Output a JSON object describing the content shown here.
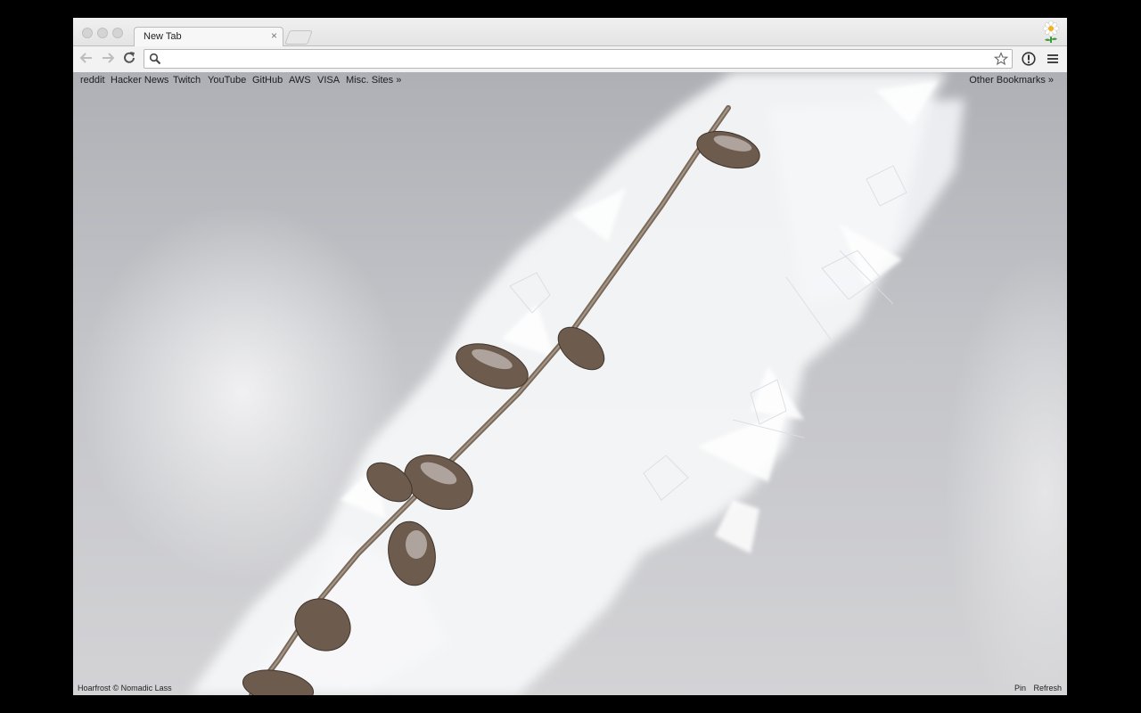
{
  "tab": {
    "title": "New Tab",
    "close_glyph": "×"
  },
  "omnibox": {
    "value": "",
    "placeholder": ""
  },
  "bookmarks": [
    {
      "label": "reddit"
    },
    {
      "label": "Hacker News"
    },
    {
      "label": "Twitch"
    },
    {
      "label": "YouTube"
    },
    {
      "label": "GitHub"
    },
    {
      "label": "AWS"
    },
    {
      "label": "VISA"
    },
    {
      "label": "Misc. Sites »"
    }
  ],
  "other_bookmarks": "Other Bookmarks »",
  "footer": {
    "credit": "Hoarfrost © Nomadic Lass",
    "pin": "Pin",
    "refresh": "Refresh"
  },
  "icons": {
    "back": "back-arrow-icon",
    "forward": "forward-arrow-icon",
    "reload": "reload-icon",
    "search": "search-icon",
    "star": "star-icon",
    "info": "info-icon",
    "menu": "hamburger-menu-icon",
    "profile": "flower-avatar-icon"
  }
}
